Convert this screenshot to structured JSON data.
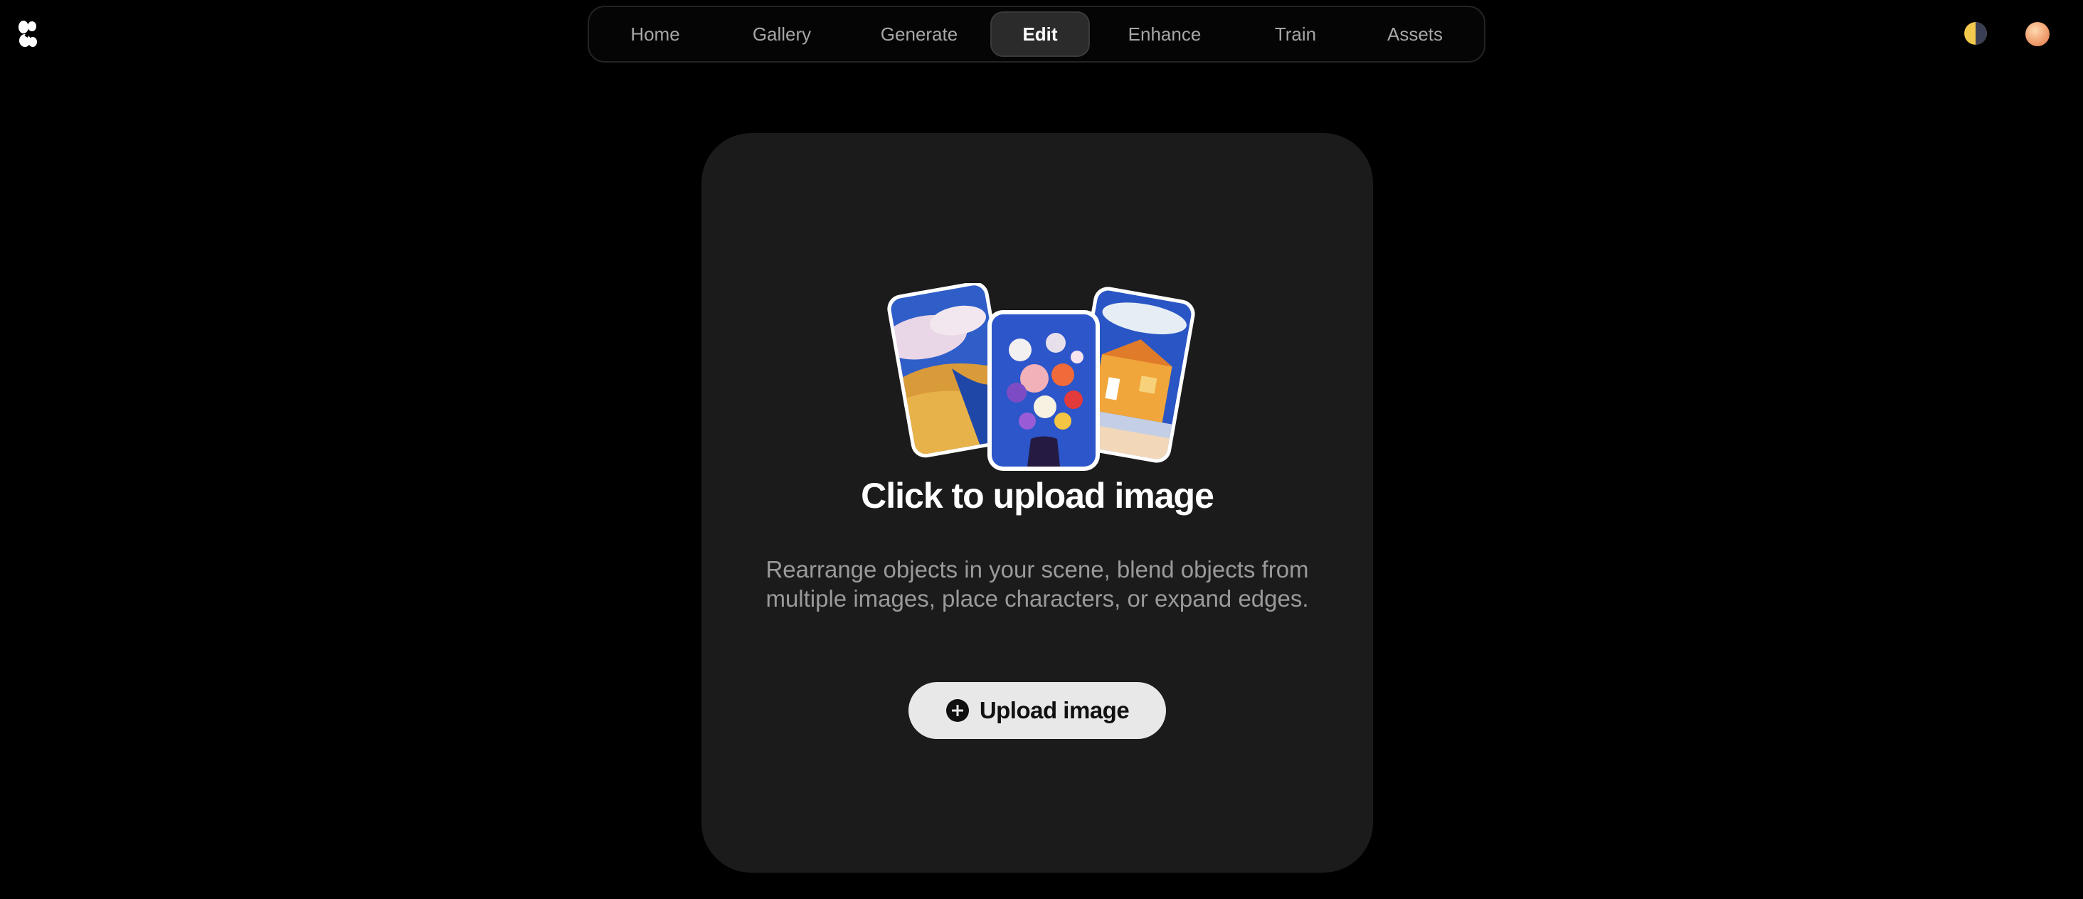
{
  "nav": {
    "items": [
      {
        "label": "Home",
        "active": false
      },
      {
        "label": "Gallery",
        "active": false
      },
      {
        "label": "Generate",
        "active": false
      },
      {
        "label": "Edit",
        "active": true
      },
      {
        "label": "Enhance",
        "active": false
      },
      {
        "label": "Train",
        "active": false
      },
      {
        "label": "Assets",
        "active": false
      }
    ]
  },
  "icons": {
    "logo": "krea-logo-icon",
    "theme": "theme-toggle-icon",
    "avatar": "user-avatar",
    "upload": "plus-circle-icon"
  },
  "upload": {
    "title": "Click to upload image",
    "description": "Rearrange objects in your scene, blend objects from multiple images, place characters, or expand edges.",
    "button_label": "Upload image"
  },
  "colors": {
    "background": "#000000",
    "card": "#1b1b1b",
    "nav_active": "#2b2b2b",
    "button": "#e8e8e8"
  }
}
